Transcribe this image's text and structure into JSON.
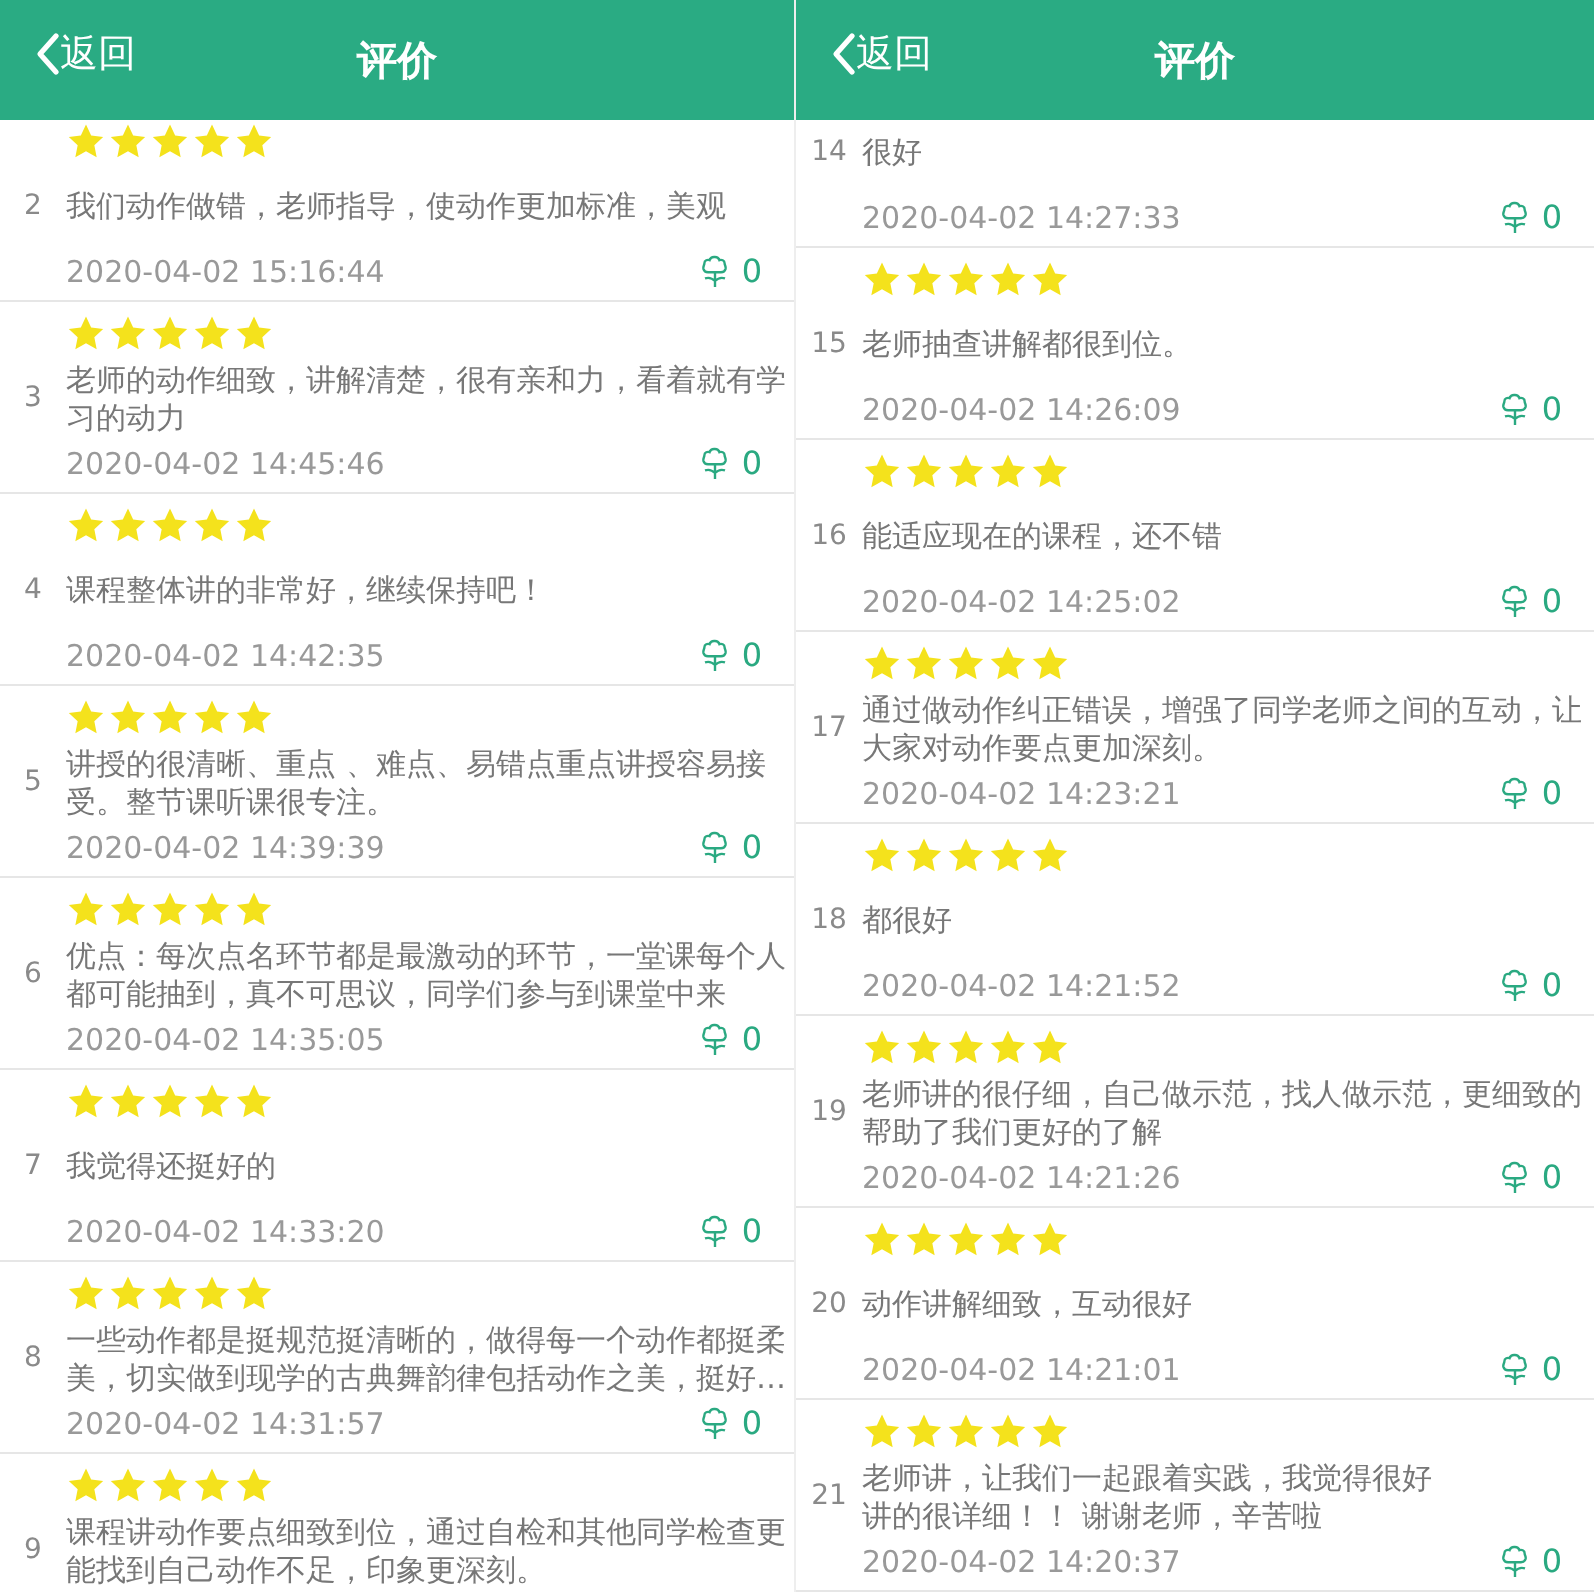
{
  "panels": [
    {
      "header": {
        "back": "返回",
        "title": "评价"
      },
      "reviews": [
        {
          "index": "2",
          "stars": 5,
          "text": "我们动作做错，老师指导，使动作更加标准，美观",
          "time": "2020-04-02 15:16:44",
          "likes": "0"
        },
        {
          "index": "3",
          "stars": 5,
          "text": "老师的动作细致，讲解清楚，很有亲和力，看着就有学习的动力",
          "time": "2020-04-02 14:45:46",
          "likes": "0"
        },
        {
          "index": "4",
          "stars": 5,
          "text": "课程整体讲的非常好，继续保持吧！",
          "time": "2020-04-02 14:42:35",
          "likes": "0"
        },
        {
          "index": "5",
          "stars": 5,
          "text": "讲授的很清晰、重点 、难点、易错点重点讲授容易接受。整节课听课很专注。",
          "time": "2020-04-02 14:39:39",
          "likes": "0"
        },
        {
          "index": "6",
          "stars": 5,
          "text": "优点：每次点名环节都是最激动的环节，一堂课每个人都可能抽到，真不可思议，同学们参与到课堂中来",
          "time": "2020-04-02 14:35:05",
          "likes": "0"
        },
        {
          "index": "7",
          "stars": 5,
          "text": "我觉得还挺好的",
          "time": "2020-04-02 14:33:20",
          "likes": "0"
        },
        {
          "index": "8",
          "stars": 5,
          "text": "一些动作都是挺规范挺清晰的，做得每一个动作都挺柔美，切实做到现学的古典舞韵律包括动作之美，挺好…",
          "time": "2020-04-02 14:31:57",
          "likes": "0"
        },
        {
          "index": "9",
          "stars": 5,
          "text": "课程讲动作要点细致到位，通过自检和其他同学检查更能找到自己动作不足，印象更深刻。"
        }
      ]
    },
    {
      "header": {
        "back": "返回",
        "title": "评价"
      },
      "reviews": [
        {
          "index": "14",
          "text": "很好",
          "time": "2020-04-02 14:27:33",
          "likes": "0"
        },
        {
          "index": "15",
          "stars": 5,
          "text": "老师抽查讲解都很到位。",
          "time": "2020-04-02 14:26:09",
          "likes": "0"
        },
        {
          "index": "16",
          "stars": 5,
          "text": "能适应现在的课程，还不错",
          "time": "2020-04-02 14:25:02",
          "likes": "0"
        },
        {
          "index": "17",
          "stars": 5,
          "text": "通过做动作纠正错误，增强了同学老师之间的互动，让大家对动作要点更加深刻。",
          "time": "2020-04-02 14:23:21",
          "likes": "0"
        },
        {
          "index": "18",
          "stars": 5,
          "text": "都很好",
          "time": "2020-04-02 14:21:52",
          "likes": "0"
        },
        {
          "index": "19",
          "stars": 5,
          "text": "老师讲的很仔细，自己做示范，找人做示范，更细致的帮助了我们更好的了解",
          "time": "2020-04-02 14:21:26",
          "likes": "0"
        },
        {
          "index": "20",
          "stars": 5,
          "text": "动作讲解细致，互动很好",
          "time": "2020-04-02 14:21:01",
          "likes": "0"
        },
        {
          "index": "21",
          "stars": 5,
          "text": [
            "老师讲，让我们一起跟着实践，我觉得很好",
            "讲的很详细！！ 谢谢老师，辛苦啦"
          ],
          "time": "2020-04-02 14:20:37",
          "likes": "0"
        }
      ]
    }
  ]
}
